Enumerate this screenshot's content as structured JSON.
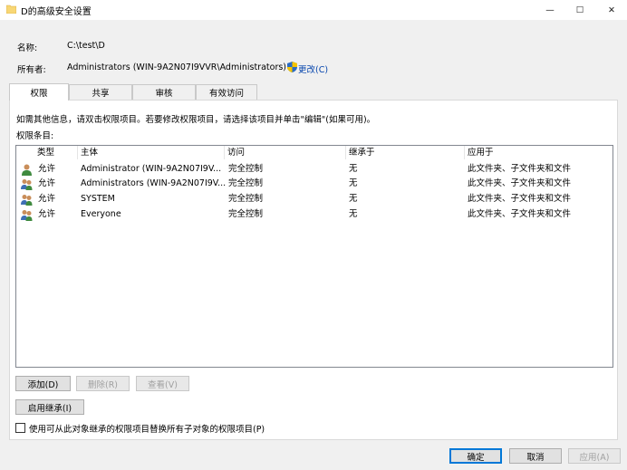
{
  "window": {
    "title": "D的高级安全设置",
    "icon": "folder-icon",
    "controls": {
      "minimize": "—",
      "maximize": "☐",
      "close": "✕"
    }
  },
  "info": {
    "name_label": "名称:",
    "name_value": "C:\\test\\D",
    "owner_label": "所有者:",
    "owner_value": "Administrators (WIN-9A2N07I9VVR\\Administrators)",
    "change_link": "更改(C)"
  },
  "tabs": [
    {
      "label": "权限",
      "active": true
    },
    {
      "label": "共享",
      "active": false
    },
    {
      "label": "审核",
      "active": false
    },
    {
      "label": "有效访问",
      "active": false
    }
  ],
  "permissions": {
    "hint": "如需其他信息，请双击权限项目。若要修改权限项目，请选择该项目并单击\"编辑\"(如果可用)。",
    "list_label": "权限条目:",
    "columns": [
      "类型",
      "主体",
      "访问",
      "继承于",
      "应用于"
    ],
    "rows": [
      {
        "icon": "user-icon",
        "type": "允许",
        "principal": "Administrator (WIN-9A2N07I9V...",
        "access": "完全控制",
        "inherited": "无",
        "applies": "此文件夹、子文件夹和文件"
      },
      {
        "icon": "group-icon",
        "type": "允许",
        "principal": "Administrators (WIN-9A2N07I9V...",
        "access": "完全控制",
        "inherited": "无",
        "applies": "此文件夹、子文件夹和文件"
      },
      {
        "icon": "group-icon",
        "type": "允许",
        "principal": "SYSTEM",
        "access": "完全控制",
        "inherited": "无",
        "applies": "此文件夹、子文件夹和文件"
      },
      {
        "icon": "group-icon",
        "type": "允许",
        "principal": "Everyone",
        "access": "完全控制",
        "inherited": "无",
        "applies": "此文件夹、子文件夹和文件"
      }
    ]
  },
  "buttons": {
    "add": "添加(D)",
    "remove": "删除(R)",
    "view": "查看(V)",
    "enable_inheritance": "启用继承(I)"
  },
  "checkbox": {
    "label": "使用可从此对象继承的权限项目替换所有子对象的权限项目(P)",
    "checked": false
  },
  "footer": {
    "ok": "确定",
    "cancel": "取消",
    "apply": "应用(A)"
  },
  "colors": {
    "accent": "#0078d7",
    "link": "#0645ad",
    "folder": "#f8d775"
  }
}
